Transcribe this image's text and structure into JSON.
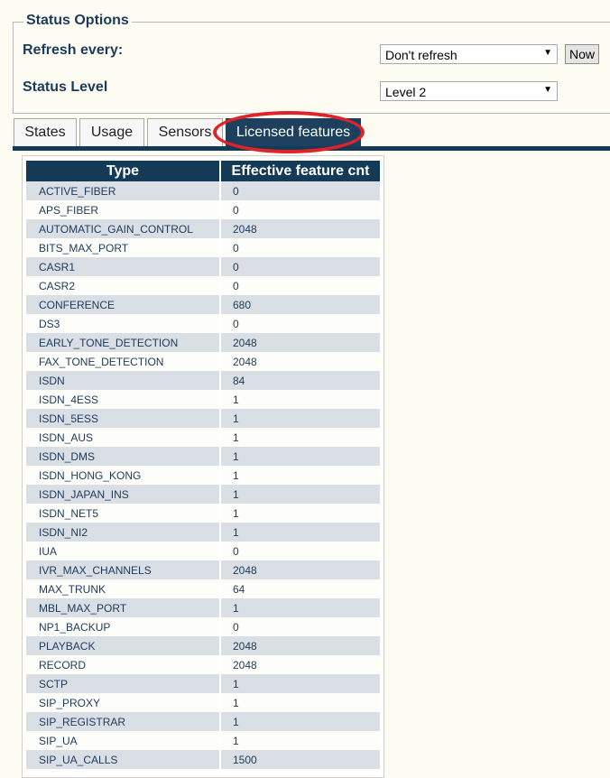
{
  "status_options": {
    "legend": "Status Options",
    "refresh_label": "Refresh every:",
    "refresh_value": "Don't refresh",
    "now_button": "Now",
    "level_label": "Status Level",
    "level_value": "Level 2"
  },
  "tabs": [
    {
      "label": "States",
      "active": false
    },
    {
      "label": "Usage",
      "active": false
    },
    {
      "label": "Sensors",
      "active": false
    },
    {
      "label": "Licensed features",
      "active": true
    }
  ],
  "table": {
    "headers": [
      "Type",
      "Effective feature cnt"
    ],
    "rows": [
      [
        "ACTIVE_FIBER",
        "0"
      ],
      [
        "APS_FIBER",
        "0"
      ],
      [
        "AUTOMATIC_GAIN_CONTROL",
        "2048"
      ],
      [
        "BITS_MAX_PORT",
        "0"
      ],
      [
        "CASR1",
        "0"
      ],
      [
        "CASR2",
        "0"
      ],
      [
        "CONFERENCE",
        "680"
      ],
      [
        "DS3",
        "0"
      ],
      [
        "EARLY_TONE_DETECTION",
        "2048"
      ],
      [
        "FAX_TONE_DETECTION",
        "2048"
      ],
      [
        "ISDN",
        "84"
      ],
      [
        "ISDN_4ESS",
        "1"
      ],
      [
        "ISDN_5ESS",
        "1"
      ],
      [
        "ISDN_AUS",
        "1"
      ],
      [
        "ISDN_DMS",
        "1"
      ],
      [
        "ISDN_HONG_KONG",
        "1"
      ],
      [
        "ISDN_JAPAN_INS",
        "1"
      ],
      [
        "ISDN_NET5",
        "1"
      ],
      [
        "ISDN_NI2",
        "1"
      ],
      [
        "IUA",
        "0"
      ],
      [
        "IVR_MAX_CHANNELS",
        "2048"
      ],
      [
        "MAX_TRUNK",
        "64"
      ],
      [
        "MBL_MAX_PORT",
        "1"
      ],
      [
        "NP1_BACKUP",
        "0"
      ],
      [
        "PLAYBACK",
        "2048"
      ],
      [
        "RECORD",
        "2048"
      ],
      [
        "SCTP",
        "1"
      ],
      [
        "SIP_PROXY",
        "1"
      ],
      [
        "SIP_REGISTRAR",
        "1"
      ],
      [
        "SIP_UA",
        "1"
      ],
      [
        "SIP_UA_CALLS",
        "1500"
      ]
    ]
  },
  "colors": {
    "header_bg": "#133a57",
    "active_tab_bg": "#1c405e",
    "highlight": "#e0222a",
    "row_stripe": "#d9dfe5"
  }
}
